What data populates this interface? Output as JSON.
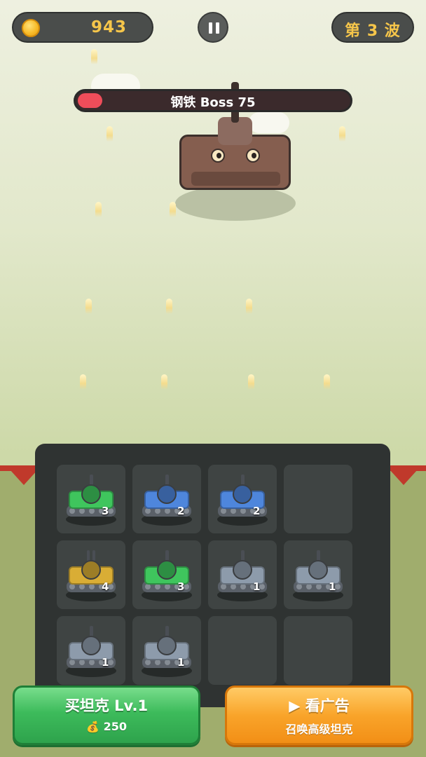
{
  "hud": {
    "coins": "943",
    "wave_label": "第 3 波"
  },
  "boss": {
    "name": "钢铁 Boss 75",
    "health_fraction": 0.09
  },
  "board": {
    "rows": [
      [
        {
          "level": "3",
          "color": "green"
        },
        {
          "level": "2",
          "color": "blue"
        },
        {
          "level": "2",
          "color": "blue"
        },
        null
      ],
      [
        {
          "level": "4",
          "color": "gold"
        },
        {
          "level": "3",
          "color": "green"
        },
        {
          "level": "1",
          "color": "gray"
        },
        {
          "level": "1",
          "color": "gray"
        }
      ],
      [
        {
          "level": "1",
          "color": "gray"
        },
        {
          "level": "1",
          "color": "gray"
        },
        null,
        null
      ]
    ]
  },
  "colors": {
    "green": "#3fc55d",
    "blue": "#4e86dc",
    "gold": "#d9ad35",
    "gray": "#8d9bab",
    "boss_health": "#ef4d5a",
    "gold_text": "#f6c64a"
  },
  "icons": {
    "coin": "coin-icon",
    "pause": "pause-icon",
    "money_bag": "money-bag-icon",
    "play": "play-icon"
  },
  "buttons": {
    "buy": {
      "title": "买坦克 Lv.1",
      "price": "250",
      "icon": "💰"
    },
    "ad": {
      "play_symbol": "▶",
      "title": "看广告",
      "subtitle": "召唤高级坦克"
    }
  }
}
